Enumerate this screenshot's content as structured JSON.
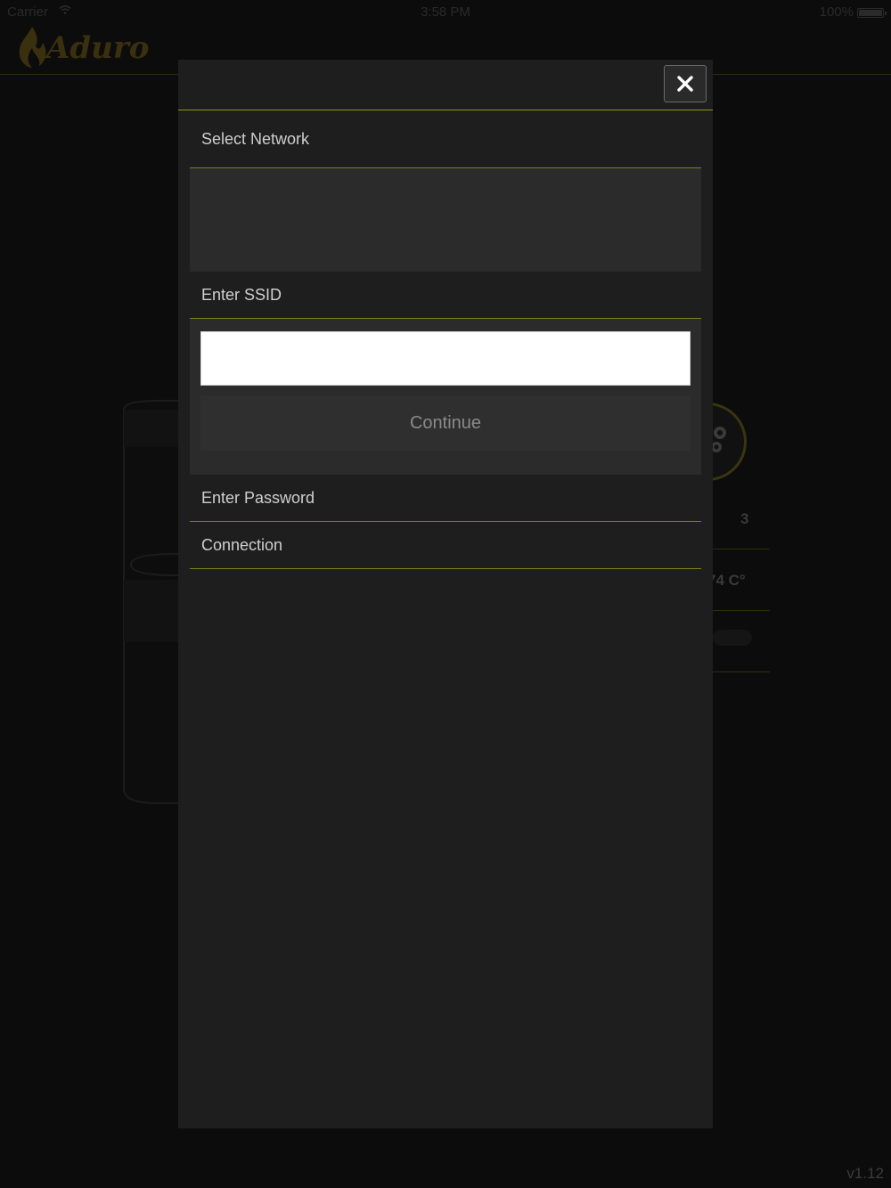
{
  "status_bar": {
    "carrier": "Carrier",
    "time": "3:58 PM",
    "battery": "100%"
  },
  "header": {
    "logo_text": "Aduro"
  },
  "background": {
    "stat_count": "3",
    "stat_temperature": "74 C°"
  },
  "modal": {
    "sections": {
      "select_network": "Select Network",
      "enter_ssid": "Enter SSID",
      "enter_password": "Enter Password",
      "connection": "Connection"
    },
    "ssid_input": {
      "value": "",
      "placeholder": ""
    },
    "continue_label": "Continue"
  },
  "version": "v1.12",
  "colors": {
    "accent_line": "#8e9418",
    "background": "#0c0c0c",
    "modal_bg": "#1e1e1e",
    "panel_bg": "#2b2b2b",
    "brand_gold": "#3a300f"
  },
  "icons": {
    "close": "close-icon",
    "wifi": "wifi-icon",
    "battery": "battery-icon",
    "logo": "flame-icon",
    "settings": "gear-icon"
  }
}
